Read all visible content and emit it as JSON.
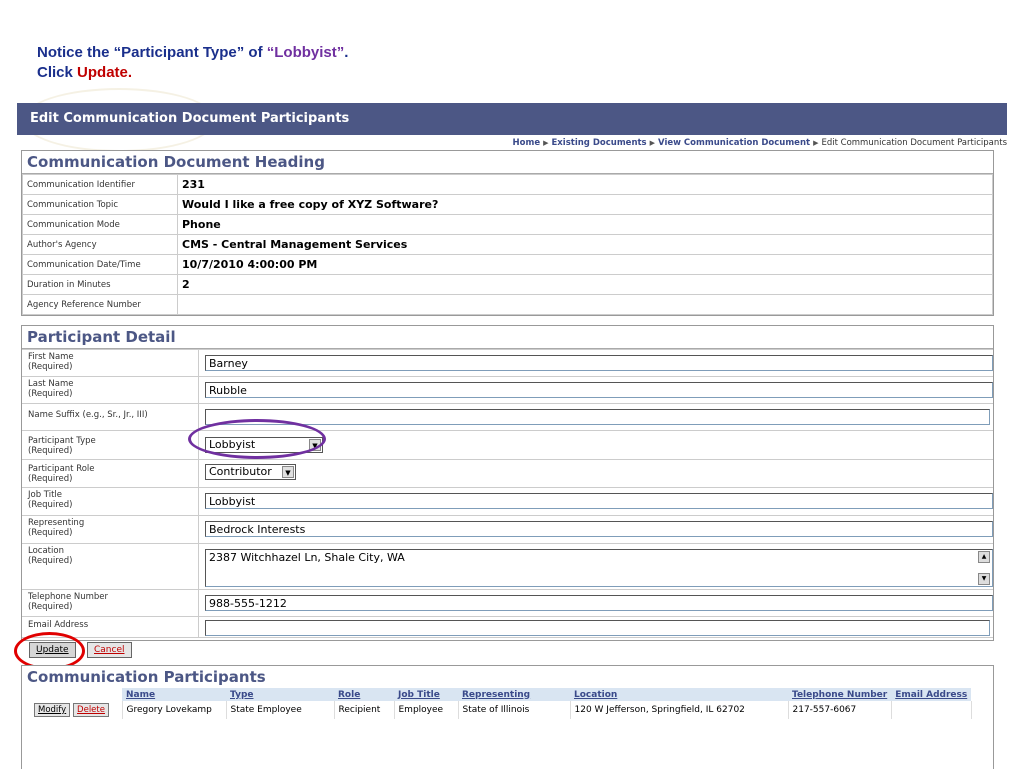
{
  "instruction": {
    "line1_prefix": "Notice the “Participant Type” of ",
    "line1_value": "“Lobbyist”",
    "line1_suffix": ".",
    "line2_prefix": "Click ",
    "line2_action": "Update."
  },
  "window_title": "Edit Communication Document Participants",
  "breadcrumbs": [
    "Home",
    "Existing Documents",
    "View Communication Document",
    "Edit Communication Document Participants"
  ],
  "heading_section": {
    "title": "Communication Document Heading",
    "rows": [
      {
        "label": "Communication Identifier",
        "value": "231"
      },
      {
        "label": "Communication Topic",
        "value": "Would I like a free copy of XYZ Software?"
      },
      {
        "label": "Communication Mode",
        "value": "Phone"
      },
      {
        "label": "Author's Agency",
        "value": "CMS - Central Management Services"
      },
      {
        "label": "Communication Date/Time",
        "value": "10/7/2010 4:00:00 PM"
      },
      {
        "label": "Duration in Minutes",
        "value": "2"
      },
      {
        "label": "Agency Reference Number",
        "value": ""
      }
    ]
  },
  "participant_detail": {
    "title": "Participant Detail",
    "first_name": {
      "label": "First Name",
      "req": "(Required)",
      "value": "Barney"
    },
    "last_name": {
      "label": "Last Name",
      "req": "(Required)",
      "value": "Rubble"
    },
    "suffix": {
      "label": "Name Suffix (e.g., Sr., Jr., III)",
      "value": ""
    },
    "type": {
      "label": "Participant Type",
      "req": "(Required)",
      "value": "Lobbyist"
    },
    "role": {
      "label": "Participant Role",
      "req": "(Required)",
      "value": "Contributor"
    },
    "job_title": {
      "label": "Job Title",
      "req": "(Required)",
      "value": "Lobbyist"
    },
    "representing": {
      "label": "Representing",
      "req": "(Required)",
      "value": "Bedrock Interests"
    },
    "location": {
      "label": "Location",
      "req": "(Required)",
      "value": "2387 Witchhazel Ln, Shale City, WA"
    },
    "telephone": {
      "label": "Telephone Number",
      "req": "(Required)",
      "value": "988-555-1212"
    },
    "email": {
      "label": "Email Address",
      "value": ""
    }
  },
  "buttons": {
    "update": "Update",
    "cancel": "Cancel",
    "modify": "Modify",
    "delete": "Delete"
  },
  "participants": {
    "title": "Communication Participants",
    "columns": [
      "Name",
      "Type",
      "Role",
      "Job Title",
      "Representing",
      "Location",
      "Telephone Number",
      "Email Address"
    ],
    "rows": [
      {
        "name": "Gregory Lovekamp",
        "type": "State Employee",
        "role": "Recipient",
        "job_title": "Employee",
        "representing": "State of Illinois",
        "location": "120 W Jefferson, Springfield, IL 62702",
        "telephone": "217-557-6067",
        "email": ""
      }
    ]
  },
  "colors": {
    "title_bar": "#4c5785",
    "accent_text": "#1a2f8c",
    "highlight_purple": "#7030a0",
    "highlight_red": "#e00000"
  }
}
